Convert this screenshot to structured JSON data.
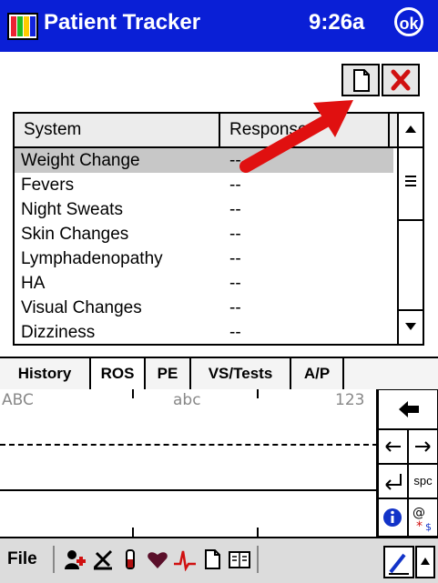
{
  "titlebar": {
    "title": "Patient Tracker",
    "time": "9:26a",
    "ok_label": "ok"
  },
  "toolbar": {
    "new_icon": "new-document-icon",
    "delete_icon": "delete-x-icon"
  },
  "list": {
    "columns": [
      "System",
      "Response"
    ],
    "rows": [
      {
        "system": "Weight Change",
        "response": "--",
        "selected": true
      },
      {
        "system": "Fevers",
        "response": "--"
      },
      {
        "system": "Night Sweats",
        "response": "--"
      },
      {
        "system": "Skin Changes",
        "response": "--"
      },
      {
        "system": "Lymphadenopathy",
        "response": "--"
      },
      {
        "system": "HA",
        "response": "--"
      },
      {
        "system": "Visual Changes",
        "response": "--"
      },
      {
        "system": "Dizziness",
        "response": "--"
      }
    ]
  },
  "tabs": [
    "History",
    "ROS",
    "PE",
    "VS/Tests",
    "A/P"
  ],
  "active_tab": "ROS",
  "input_panel": {
    "label_upper": "ABC",
    "label_lower": "abc",
    "label_num": "123",
    "space_key": "spc"
  },
  "menubar": {
    "file_label": "File"
  },
  "colors": {
    "titlebar": "#0a1fd6",
    "annotation_arrow": "#e01010",
    "delete_x": "#d01010"
  }
}
